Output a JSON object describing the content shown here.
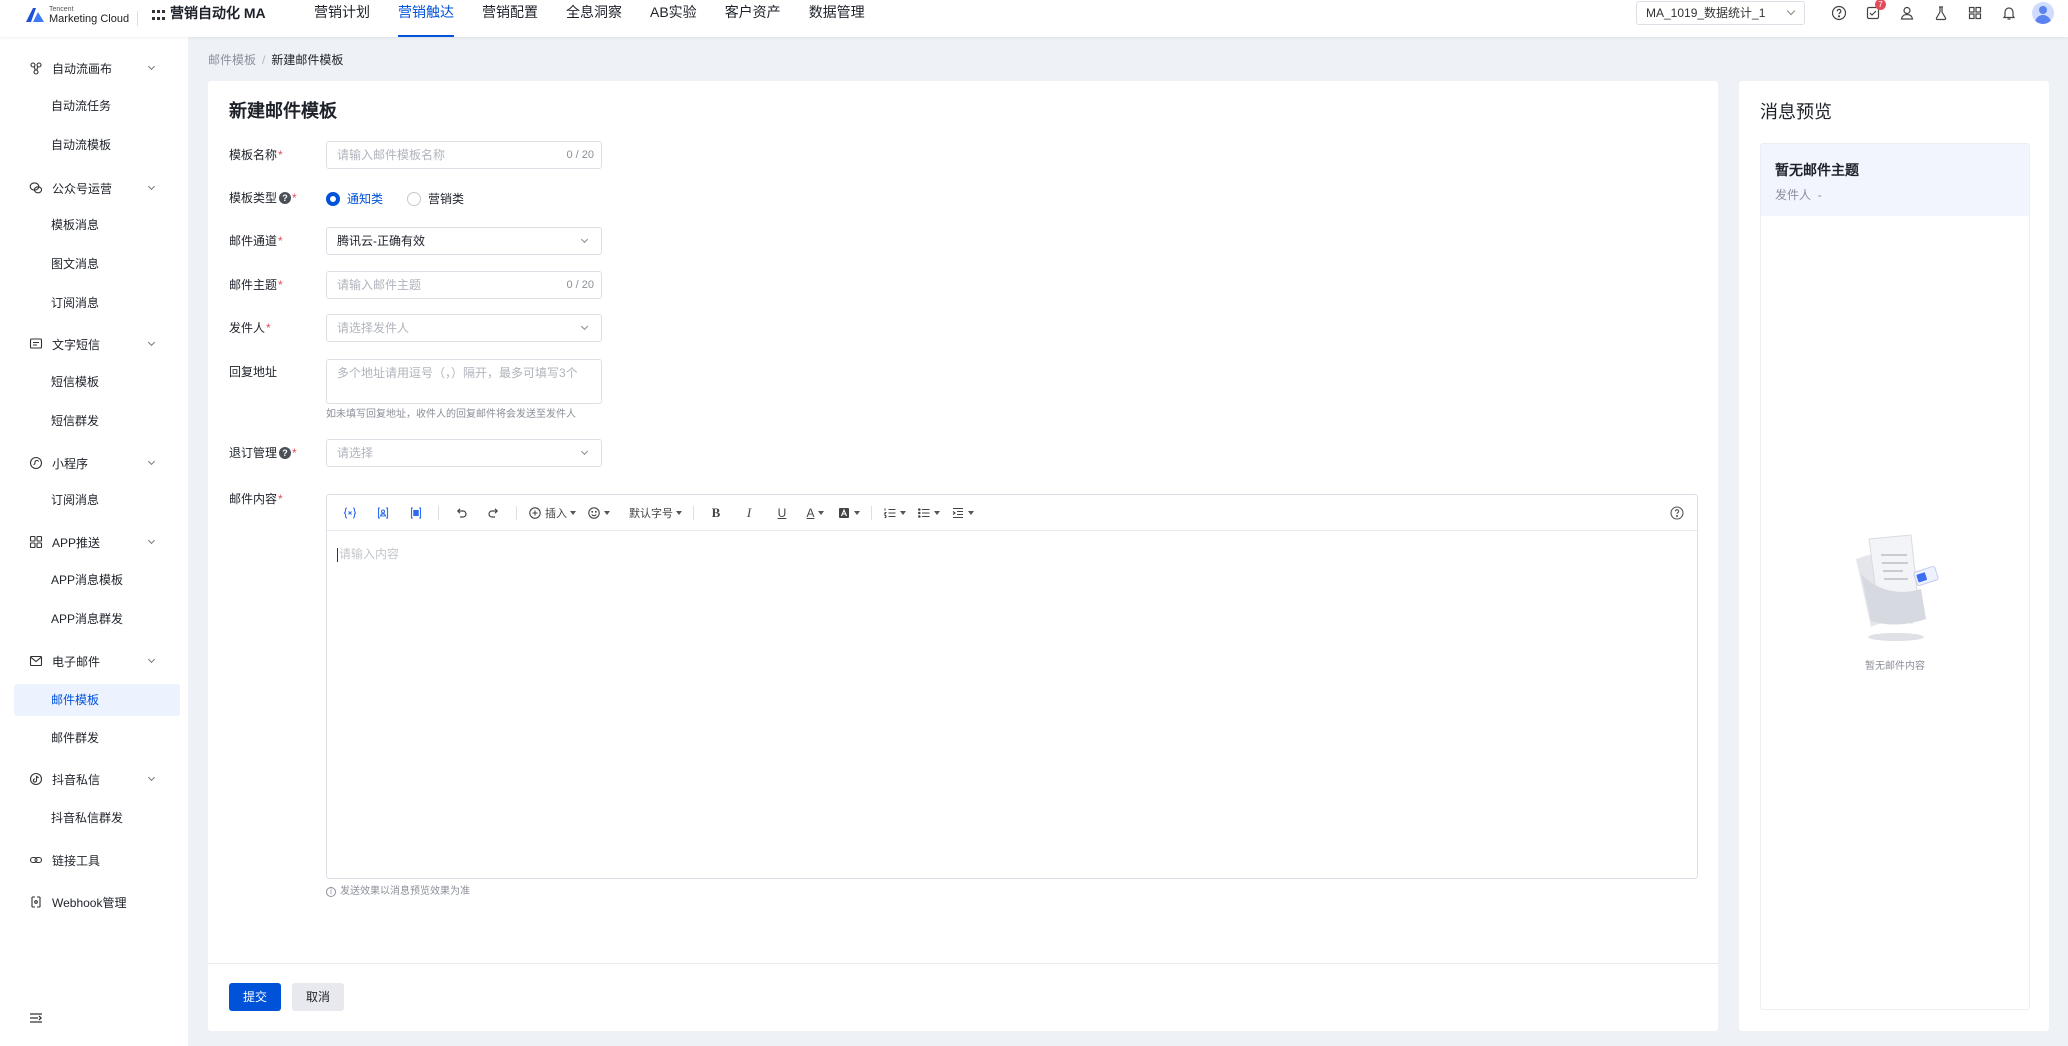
{
  "brand": {
    "logo_small": "Tencent",
    "logo_text": "Marketing Cloud",
    "app_name": "营销自动化 MA"
  },
  "top_nav": {
    "items": [
      {
        "label": "营销计划"
      },
      {
        "label": "营销触达",
        "active": true
      },
      {
        "label": "营销配置"
      },
      {
        "label": "全息洞察"
      },
      {
        "label": "AB实验"
      },
      {
        "label": "客户资产"
      },
      {
        "label": "数据管理"
      }
    ],
    "account": "MA_1019_数据统计_1",
    "icons": [
      "help-icon",
      "todo-icon",
      "user-icon",
      "flask-icon",
      "apps-icon",
      "bell-icon"
    ],
    "todo_badge": "7",
    "accent": "#0052d9"
  },
  "sidebar": {
    "groups": [
      {
        "label": "自动流画布",
        "icon": "flow-icon",
        "items": [
          "自动流任务",
          "自动流模板"
        ]
      },
      {
        "label": "公众号运营",
        "icon": "wechat-icon",
        "items": [
          "模板消息",
          "图文消息",
          "订阅消息"
        ]
      },
      {
        "label": "文字短信",
        "icon": "sms-icon",
        "items": [
          "短信模板",
          "短信群发"
        ]
      },
      {
        "label": "小程序",
        "icon": "miniprogram-icon",
        "items": [
          "订阅消息"
        ]
      },
      {
        "label": "APP推送",
        "icon": "app-icon",
        "items": [
          "APP消息模板",
          "APP消息群发"
        ]
      },
      {
        "label": "电子邮件",
        "icon": "mail-icon",
        "items": [
          "邮件模板",
          "邮件群发"
        ],
        "active_item": "邮件模板"
      },
      {
        "label": "抖音私信",
        "icon": "douyin-icon",
        "items": [
          "抖音私信群发"
        ]
      }
    ],
    "links": [
      {
        "label": "链接工具",
        "icon": "link-icon"
      },
      {
        "label": "Webhook管理",
        "icon": "webhook-icon"
      }
    ]
  },
  "breadcrumb": {
    "parent": "邮件模板",
    "separator": "/",
    "current": "新建邮件模板"
  },
  "form": {
    "title": "新建邮件模板",
    "name": {
      "label": "模板名称",
      "placeholder": "请输入邮件模板名称",
      "count": "0 / 20"
    },
    "type": {
      "label": "模板类型",
      "options": [
        "通知类",
        "营销类"
      ],
      "selected": "通知类"
    },
    "channel": {
      "label": "邮件通道",
      "value": "腾讯云-正确有效"
    },
    "subject": {
      "label": "邮件主题",
      "placeholder": "请输入邮件主题",
      "count": "0 / 20"
    },
    "sender": {
      "label": "发件人",
      "placeholder": "请选择发件人"
    },
    "reply": {
      "label": "回复地址",
      "placeholder": "多个地址请用逗号（，）隔开，最多可填写3个",
      "hint": "如未填写回复地址，收件人的回复邮件将会发送至发件人"
    },
    "unsubscribe": {
      "label": "退订管理",
      "placeholder": "请选择"
    },
    "content": {
      "label": "邮件内容",
      "placeholder": "请输入内容",
      "toolbar": {
        "insert": "插入",
        "font_size": "默认字号"
      },
      "note": "发送效果以消息预览效果为准"
    },
    "submit": "提交",
    "cancel": "取消"
  },
  "preview": {
    "title": "消息预览",
    "subject": "暂无邮件主题",
    "sender_label": "发件人",
    "sender_value": "-",
    "empty": "暂无邮件内容"
  }
}
